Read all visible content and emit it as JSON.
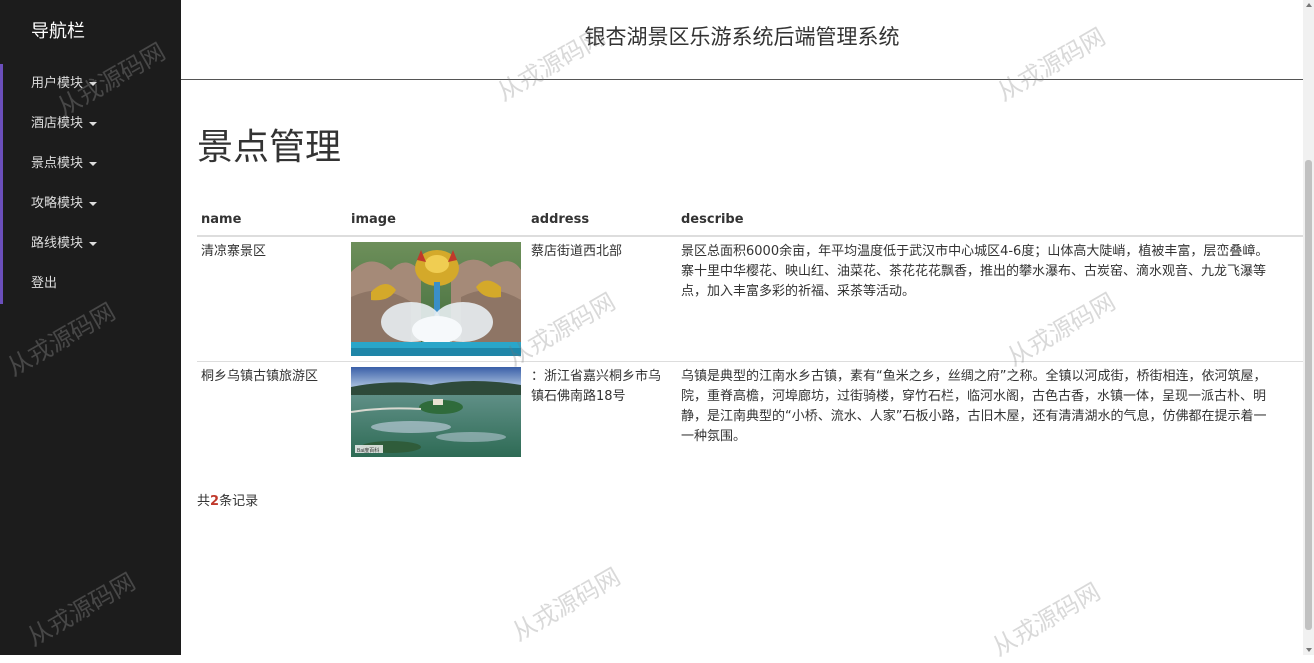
{
  "sidebar": {
    "brand": "导航栏",
    "items": [
      {
        "label": "用户模块",
        "dropdown": true
      },
      {
        "label": "酒店模块",
        "dropdown": true
      },
      {
        "label": "景点模块",
        "dropdown": true
      },
      {
        "label": "攻略模块",
        "dropdown": true
      },
      {
        "label": "路线模块",
        "dropdown": true
      },
      {
        "label": "登出",
        "dropdown": false
      }
    ]
  },
  "header": {
    "title": "银杏湖景区乐游系统后端管理系统"
  },
  "main": {
    "page_title": "景点管理",
    "table": {
      "columns": [
        "name",
        "image",
        "address",
        "describe"
      ],
      "rows": [
        {
          "name": "清凉寨景区",
          "address": "蔡店街道西北部",
          "describe": [
            "景区总面积6000余亩，年平均温度低于武汉市中心城区4-6度；山体高大陡峭，植被丰富，层峦叠嶂。",
            "寨十里中华樱花、映山红、油菜花、茶花花花飘香，推出的攀水瀑布、古炭窑、滴水观音、九龙飞瀑等",
            "点，加入丰富多彩的祈福、采茶等活动。"
          ],
          "image_desc": "golden-dragon-fountain"
        },
        {
          "name": "桐乡乌镇古镇旅游区",
          "address": "：浙江省嘉兴桐乡市乌镇石佛南路18号",
          "describe": [
            "乌镇是典型的江南水乡古镇，素有“鱼米之乡，丝绸之府”之称。全镇以河成街，桥街相连，依河筑屋，",
            "院，重脊高檐，河埠廊坊，过街骑楼，穿竹石栏，临河水阁，古色古香，水镇一体，呈现一派古朴、明",
            "静，是江南典型的“小桥、流水、人家”石板小路，古旧木屋，还有清清湖水的气息，仿佛都在提示着一",
            "一种氛围。"
          ],
          "image_desc": "lake-island-bridge",
          "image_watermark": "Bai度百科"
        }
      ]
    },
    "summary": {
      "prefix": "共",
      "count": "2",
      "suffix": "条记录"
    }
  },
  "watermark_text": "从戎源码网",
  "colors": {
    "sidebar_bg": "#1c1c1c",
    "sidebar_accent": "#6b4fbb",
    "count_red": "#c0392b"
  }
}
